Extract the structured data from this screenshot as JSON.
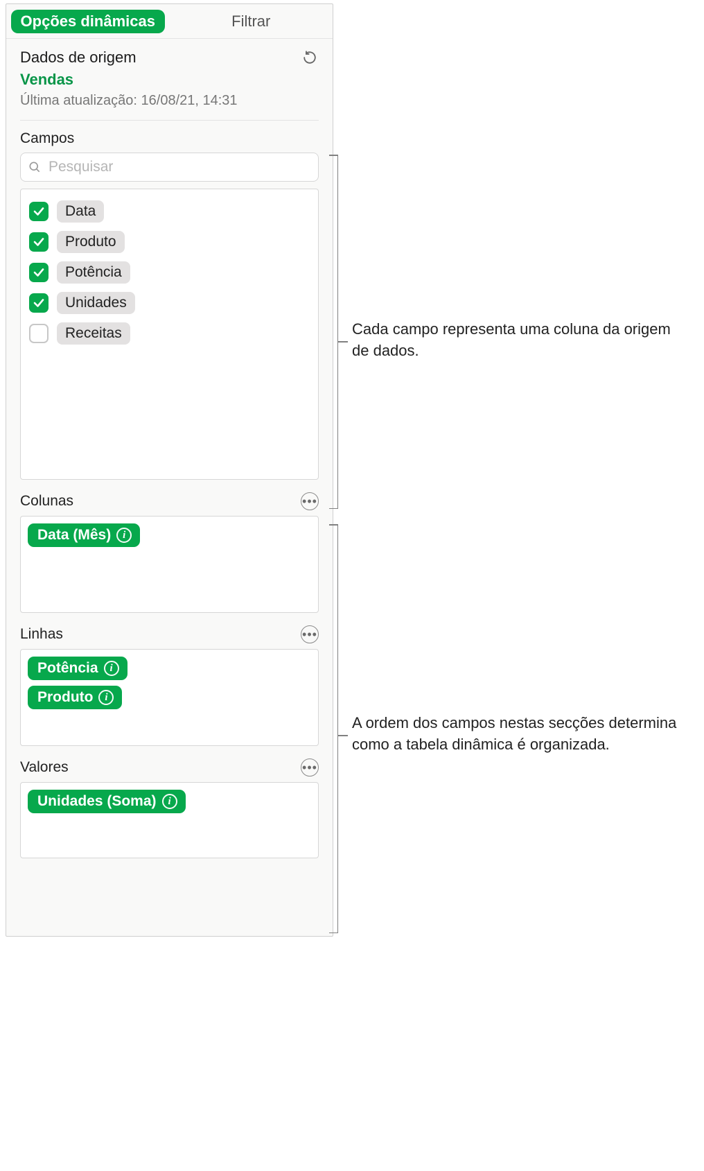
{
  "tabs": {
    "active": "Opções dinâmicas",
    "inactive": "Filtrar"
  },
  "source": {
    "label": "Dados de origem",
    "name": "Vendas",
    "updated": "Última atualização: 16/08/21,  14:31"
  },
  "fields": {
    "label": "Campos",
    "search_placeholder": "Pesquisar",
    "items": [
      {
        "label": "Data",
        "checked": true
      },
      {
        "label": "Produto",
        "checked": true
      },
      {
        "label": "Potência",
        "checked": true
      },
      {
        "label": "Unidades",
        "checked": true
      },
      {
        "label": "Receitas",
        "checked": false
      }
    ]
  },
  "zones": {
    "columns": {
      "label": "Colunas",
      "items": [
        "Data (Mês)"
      ]
    },
    "rows": {
      "label": "Linhas",
      "items": [
        "Potência",
        "Produto"
      ]
    },
    "values": {
      "label": "Valores",
      "items": [
        "Unidades (Soma)"
      ]
    }
  },
  "callouts": {
    "fields": "Cada campo representa uma coluna da origem de dados.",
    "zones": "A ordem dos campos nestas secções determina como a tabela dinâmica é organizada."
  }
}
